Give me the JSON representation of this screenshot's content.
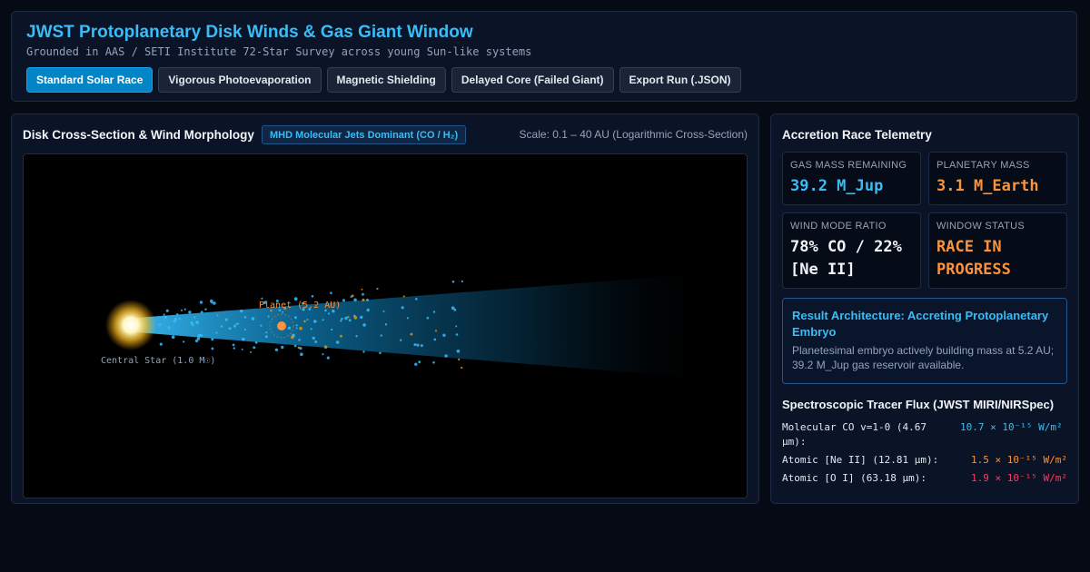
{
  "header": {
    "title": "JWST Protoplanetary Disk Winds & Gas Giant Window",
    "subtitle": "Grounded in AAS / SETI Institute 72-Star Survey across young Sun-like systems",
    "buttons": [
      {
        "label": "Standard Solar Race",
        "active": true
      },
      {
        "label": "Vigorous Photoevaporation",
        "active": false
      },
      {
        "label": "Magnetic Shielding",
        "active": false
      },
      {
        "label": "Delayed Core (Failed Giant)",
        "active": false
      },
      {
        "label": "Export Run (.JSON)",
        "active": false
      }
    ]
  },
  "visualization": {
    "title": "Disk Cross-Section & Wind Morphology",
    "mode_badge": "MHD Molecular Jets Dominant (CO / H₂)",
    "scale_label": "Scale: 0.1 – 40 AU (Logarithmic Cross-Section)",
    "star_label": "Central Star (1.0 M☉)",
    "planet_label": "Planet (5.2 AU)"
  },
  "telemetry": {
    "title": "Accretion Race Telemetry",
    "cards": [
      {
        "label": "Gas Mass Remaining",
        "value": "39.2 M_Jup",
        "color": "#38bdf8"
      },
      {
        "label": "Planetary Mass",
        "value": "3.1 M_Earth",
        "color": "#fb923c"
      },
      {
        "label": "Wind Mode Ratio",
        "value": "78% CO / 22% [Ne II]",
        "color": "#f1f5f9"
      },
      {
        "label": "Window Status",
        "value": "RACE IN PROGRESS",
        "color": "#fb923c"
      }
    ],
    "result": {
      "title": "Result Architecture: Accreting Protoplanetary Embryo",
      "text": "Planetesimal embryo actively building mass at 5.2 AU; 39.2 M_Jup gas reservoir available."
    },
    "flux": {
      "title": "Spectroscopic Tracer Flux (JWST MIRI/NIRSpec)",
      "rows": [
        {
          "name": "Molecular CO v=1-0 (4.67 μm):",
          "value": "10.7 × 10⁻¹⁵ W/m²",
          "color": "#38bdf8"
        },
        {
          "name": "Atomic [Ne II] (12.81 μm):",
          "value": "1.5 × 10⁻¹⁵ W/m²",
          "color": "#fb923c"
        },
        {
          "name": "Atomic [O I] (63.18 μm):",
          "value": "1.9 × 10⁻¹⁵ W/m²",
          "color": "#f43f5e"
        }
      ]
    }
  }
}
